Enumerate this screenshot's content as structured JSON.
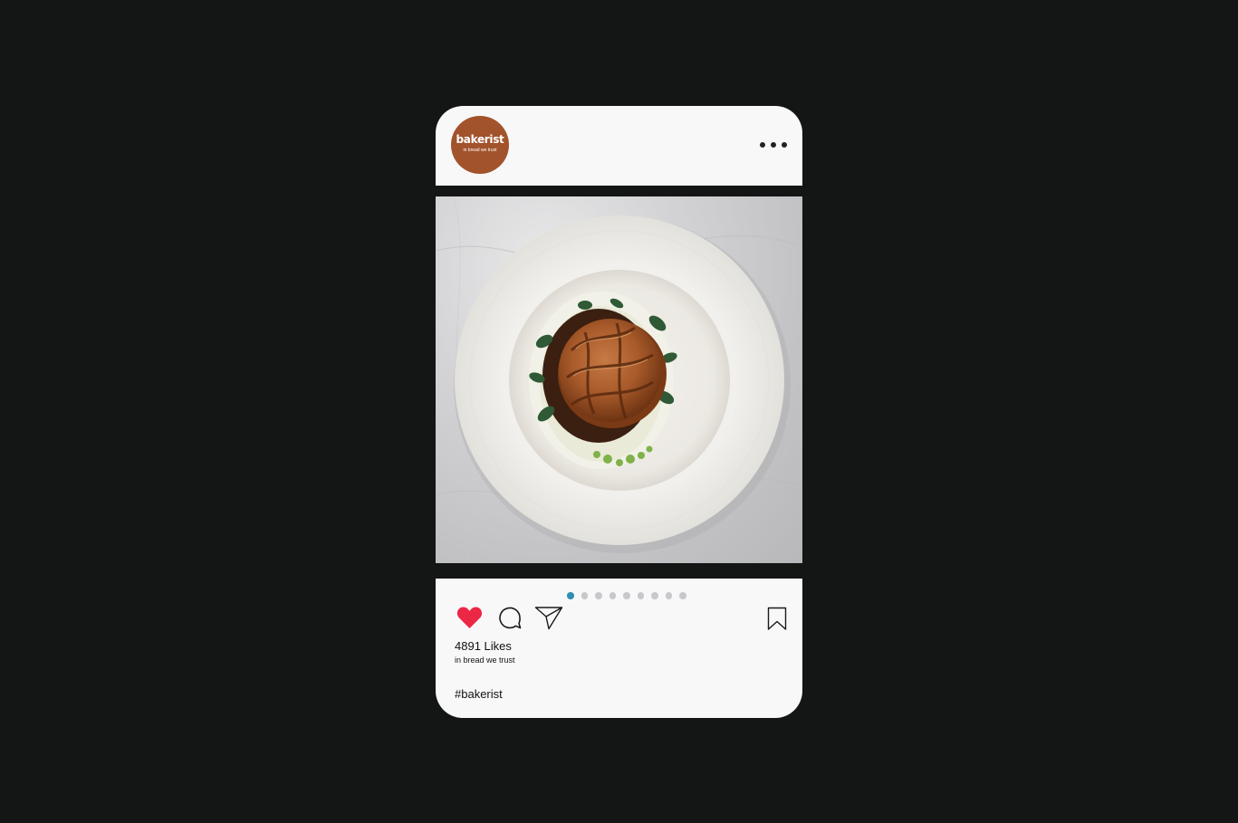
{
  "profile": {
    "brand_name": "bakerist",
    "tagline": "in bread we trust",
    "brand_color": "#a2532c"
  },
  "header": {
    "menu_icon": "more-horizontal-icon"
  },
  "carousel": {
    "total_slides": 9,
    "active_slide": 1,
    "active_color": "#2f8fb5",
    "inactive_color": "#c6c8cb"
  },
  "actions": {
    "like_icon": "heart-icon",
    "like_color": "#ec2745",
    "comment_icon": "comment-icon",
    "share_icon": "send-icon",
    "save_icon": "bookmark-icon"
  },
  "post": {
    "likes_label": "4891 Likes",
    "caption": "in bread we trust",
    "hashtag": "#bakerist"
  }
}
